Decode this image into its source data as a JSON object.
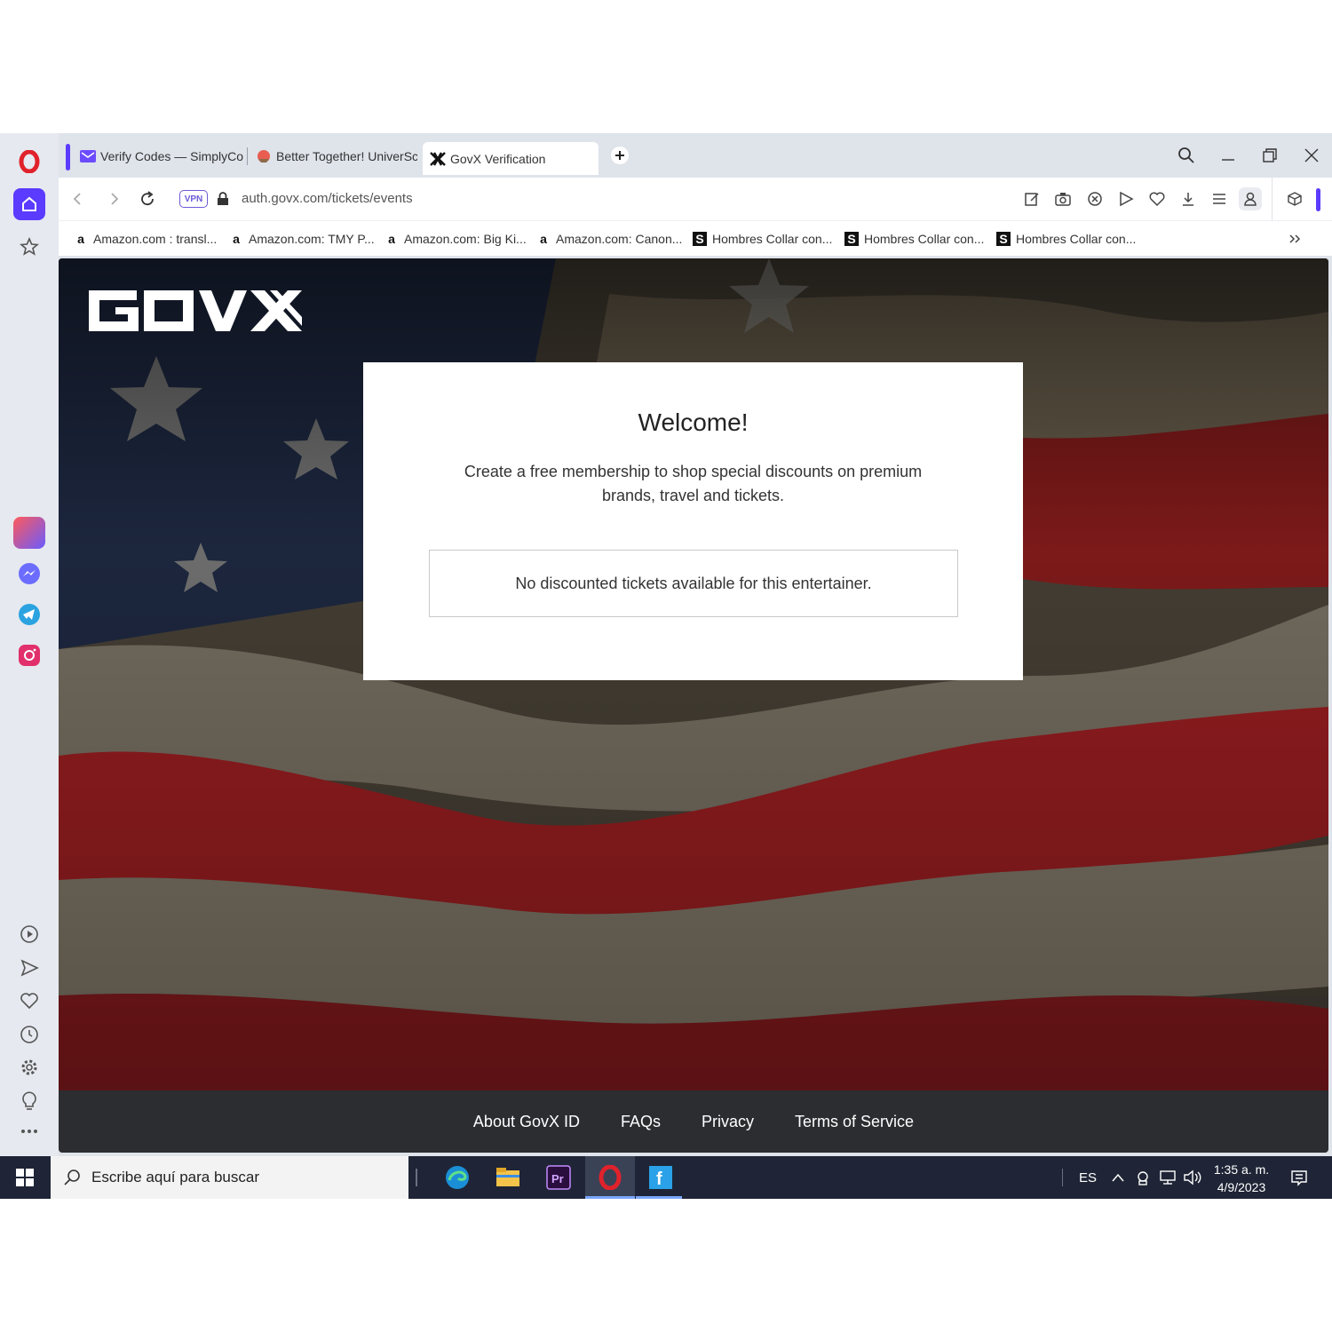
{
  "tabs": [
    {
      "label": "Verify Codes — SimplyCo",
      "icon": "simplylogin-icon",
      "active": false
    },
    {
      "label": "Better Together! UniverSc",
      "icon": "universal-icon",
      "active": false
    },
    {
      "label": "GovX Verification",
      "icon": "govx-favicon-icon",
      "active": true
    }
  ],
  "address": {
    "vpn_label": "VPN",
    "url": "auth.govx.com/tickets/events"
  },
  "bookmarks": [
    {
      "label": "Amazon.com : transl...",
      "icon": "a"
    },
    {
      "label": "Amazon.com: TMY P...",
      "icon": "a"
    },
    {
      "label": "Amazon.com: Big Ki...",
      "icon": "a"
    },
    {
      "label": "Amazon.com: Canon...",
      "icon": "a"
    },
    {
      "label": "Hombres Collar con...",
      "icon": "S"
    },
    {
      "label": "Hombres Collar con...",
      "icon": "S"
    },
    {
      "label": "Hombres Collar con...",
      "icon": "S"
    }
  ],
  "page": {
    "logo_text": "GOVX",
    "card": {
      "title": "Welcome!",
      "subtitle": "Create a free membership to shop special discounts on premium brands, travel and tickets.",
      "notice": "No discounted tickets available for this entertainer."
    },
    "footer_links": [
      "About GovX ID",
      "FAQs",
      "Privacy",
      "Terms of Service"
    ]
  },
  "taskbar": {
    "search_placeholder": "Escribe aquí para buscar",
    "language": "ES",
    "time": "1:35 a. m.",
    "date": "4/9/2023"
  },
  "colors": {
    "opera_red": "#e0222b",
    "opera_accent": "#5a3bff",
    "footer_bg": "#2b2d31",
    "taskbar_bg": "#1f2536"
  }
}
